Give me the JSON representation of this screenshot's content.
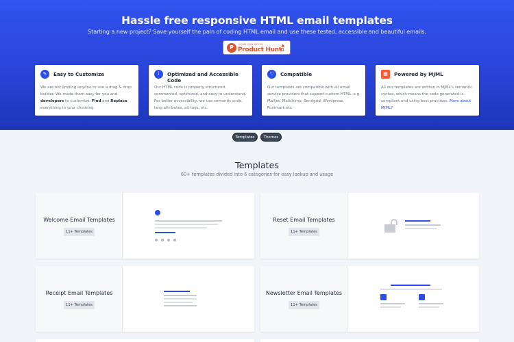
{
  "hero": {
    "title": "Hassle free responsive HTML email templates",
    "subtitle": "Starting a new project? Save yourself the pain of coding HTML email and use these tested, accessible and beautiful emails.",
    "producthunt": {
      "small": "COME JOIN US ON",
      "name": "Product Hunt",
      "logo": "P",
      "arrow": "▲",
      "count": "41"
    }
  },
  "features": [
    {
      "icon": "pencil-icon",
      "glyph": "✎",
      "title": "Easy to Customize",
      "body_parts": [
        "We are not limiting anyone to use a drag & drop builder. We made them easy for you and ",
        "developers",
        " to customize. ",
        "Find",
        " and ",
        "Replace",
        " everything to your choosing."
      ]
    },
    {
      "icon": "info-icon",
      "glyph": "i",
      "title": "Optimized and Accessible Code",
      "body": "Our HTML code is properly structured, commented, optimized, and easy to understand. For better accessibility, we use semantic code, lang attributes, alt tags, etc."
    },
    {
      "icon": "heart-icon",
      "glyph": "♡",
      "title": "Compatible",
      "body": "Our templates are compatible with all email service providers that support custom HTML. e.g Mailjet, Mailchimp, Sendgrid, Wordpress, Postmark etc"
    },
    {
      "icon": "mjml-icon",
      "glyph": "▦",
      "title": "Powered by MJML",
      "body": "All our templates are written in MJML's semantic syntax, which means the code generated is compliant and using best practices. ",
      "link": "More about MJML?"
    }
  ],
  "tabs": [
    "Templates",
    "Themes"
  ],
  "templates": {
    "title": "Templates",
    "subtitle": "60+ templates divided into 6 categories for easy lookup and usage",
    "cards": [
      {
        "name": "Welcome Email Templates",
        "badge": "11+ Templates"
      },
      {
        "name": "Reset Email Templates",
        "badge": "11+ Templates"
      },
      {
        "name": "Receipt Email Templates",
        "badge": "11+ Templates"
      },
      {
        "name": "Newsletter Email Templates",
        "badge": "11+ Templates"
      }
    ]
  },
  "colors": {
    "hero": "#2a44d8",
    "accent": "#2d4de8",
    "producthunt": "#da552f",
    "mjml": "#ff5a36"
  }
}
